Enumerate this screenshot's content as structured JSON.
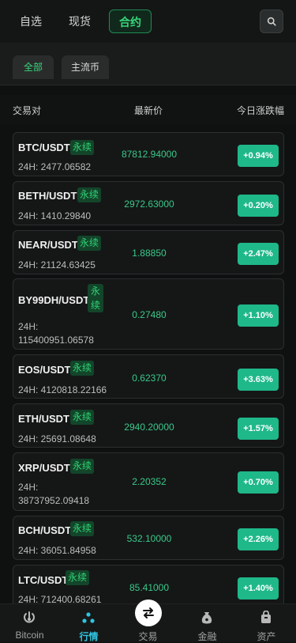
{
  "top_tabs": [
    "自选",
    "现货",
    "合约"
  ],
  "sub_tabs": [
    "全部",
    "主流币"
  ],
  "columns": {
    "pair": "交易对",
    "price": "最新价",
    "change": "今日涨跌幅"
  },
  "perp_label": "永续",
  "rows": [
    {
      "pair": "BTC/USDT",
      "vol": "24H: 2477.06582",
      "price": "87812.94000",
      "change": "+0.94%"
    },
    {
      "pair": "BETH/USDT",
      "vol": "24H: 1410.29840",
      "price": "2972.63000",
      "change": "+0.20%"
    },
    {
      "pair": "NEAR/USDT",
      "vol": "24H: 21124.63425",
      "price": "1.88850",
      "change": "+2.47%"
    },
    {
      "pair": "BY99DH/USDT",
      "vol_line1": "24H:",
      "vol_line2": "115400951.06578",
      "price": "0.27480",
      "change": "+1.10%"
    },
    {
      "pair": "EOS/USDT",
      "vol": "24H: 4120818.22166",
      "price": "0.62370",
      "change": "+3.63%"
    },
    {
      "pair": "ETH/USDT",
      "vol": "24H: 25691.08648",
      "price": "2940.20000",
      "change": "+1.57%"
    },
    {
      "pair": "XRP/USDT",
      "vol_line1": "24H:",
      "vol_line2": "38737952.09418",
      "price": "2.20352",
      "change": "+0.70%"
    },
    {
      "pair": "BCH/USDT",
      "vol": "24H: 36051.84958",
      "price": "532.10000",
      "change": "+2.26%"
    },
    {
      "pair": "LTC/USDT",
      "vol": "24H: 712400.68261",
      "price": "85.41000",
      "change": "+1.40%"
    }
  ],
  "bottom_nav": [
    {
      "label": "Bitcoin",
      "icon": "bitcoin-icon"
    },
    {
      "label": "行情",
      "icon": "market-icon"
    },
    {
      "label": "交易",
      "icon": "trade-swap-icon"
    },
    {
      "label": "金融",
      "icon": "finance-bag-icon"
    },
    {
      "label": "资产",
      "icon": "wallet-icon"
    }
  ],
  "colors": {
    "accent_green": "#37d77b",
    "change_bg": "#1fb889",
    "price_text": "#39c989",
    "active_nav": "#30c3e0"
  }
}
